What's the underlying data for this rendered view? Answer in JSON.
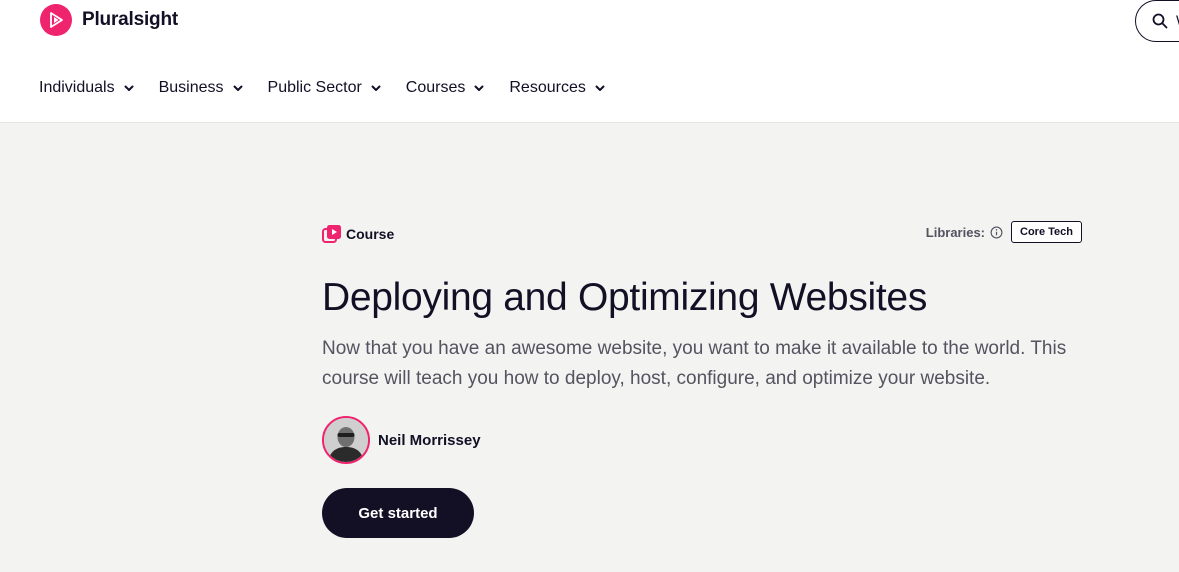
{
  "brand": {
    "name": "Pluralsight",
    "accent": "#f0246e",
    "dark": "#130f25"
  },
  "search": {
    "placeholder_visible": "W"
  },
  "nav": {
    "items": [
      {
        "label": "Individuals"
      },
      {
        "label": "Business"
      },
      {
        "label": "Public Sector"
      },
      {
        "label": "Courses"
      },
      {
        "label": "Resources"
      }
    ]
  },
  "course": {
    "type_label": "Course",
    "libraries_label": "Libraries:",
    "library_badge": "Core Tech",
    "title": "Deploying and Optimizing Websites",
    "description": "Now that you have an awesome website, you want to make it available to the world. This course will teach you how to deploy, host, configure, and optimize your website.",
    "author": "Neil Morrissey",
    "cta_label": "Get started"
  },
  "icons": {
    "logo": "pluralsight-play-icon",
    "search": "search-icon",
    "nav_chevron": "chevron-down-icon",
    "course": "course-play-icon",
    "info": "info-icon"
  }
}
